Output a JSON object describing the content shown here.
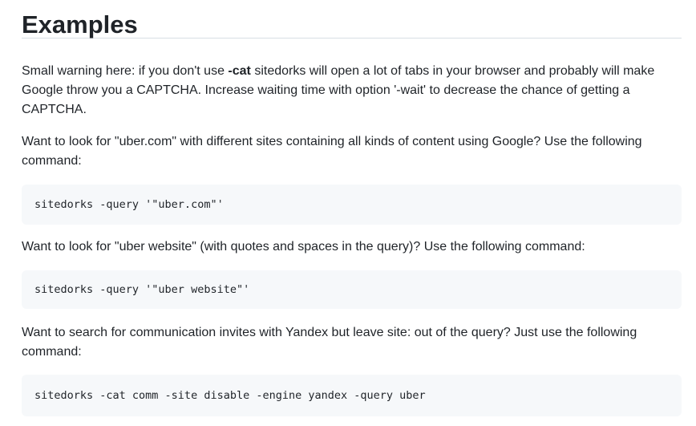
{
  "heading": "Examples",
  "p1": {
    "before": "Small warning here: if you don't use ",
    "bold": "-cat",
    "after": " sitedorks will open a lot of tabs in your browser and probably will make Google throw you a CAPTCHA. Increase waiting time with option '-wait' to decrease the chance of getting a CAPTCHA."
  },
  "p2": "Want to look for \"uber.com\" with different sites containing all kinds of content using Google? Use the following command:",
  "code1": "sitedorks -query '\"uber.com\"'",
  "p3": "Want to look for \"uber website\" (with quotes and spaces in the query)? Use the following command:",
  "code2": "sitedorks -query '\"uber website\"'",
  "p4": "Want to search for communication invites with Yandex but leave site: out of the query? Just use the following command:",
  "code3": "sitedorks -cat comm -site disable -engine yandex -query uber"
}
